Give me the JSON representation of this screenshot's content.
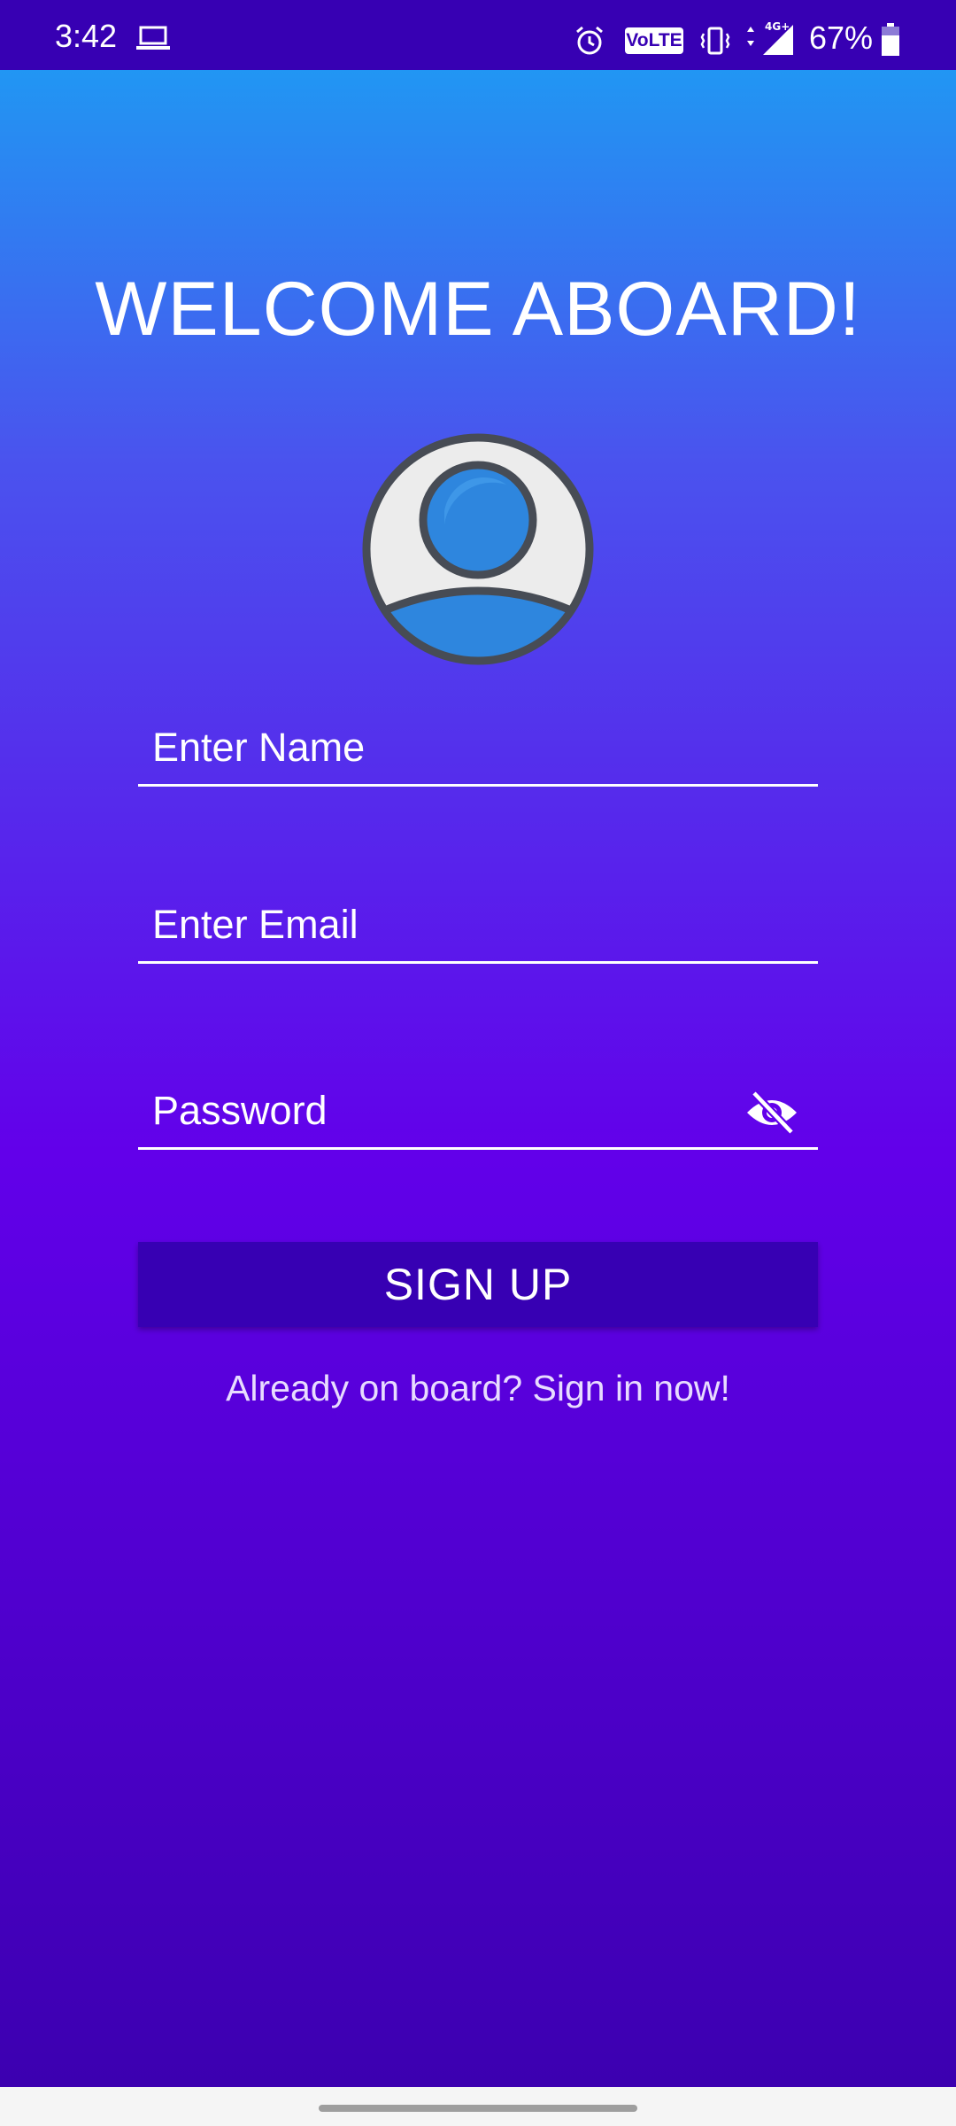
{
  "status_bar": {
    "time": "3:42",
    "battery_percent": "67%",
    "icons": [
      "laptop-icon",
      "alarm-icon",
      "volte-icon",
      "vibrate-icon",
      "4g-signal-icon",
      "battery-icon"
    ],
    "volte_label": "VoLTE",
    "network_label": "4G+"
  },
  "title": "WELCOME ABOARD!",
  "avatar_icon": "user-avatar-icon",
  "form": {
    "name_placeholder": "Enter Name",
    "email_placeholder": "Enter Email",
    "password_placeholder": "Password",
    "password_toggle_icon": "eye-off-icon",
    "signup_label": "SIGN UP",
    "signin_text": "Already on board? Sign in now!"
  },
  "colors": {
    "status_bar": "#3700b3",
    "gradient_top": "#2196f3",
    "gradient_mid": "#6200ea",
    "gradient_bottom": "#3c00b0",
    "button": "#3700b3"
  }
}
